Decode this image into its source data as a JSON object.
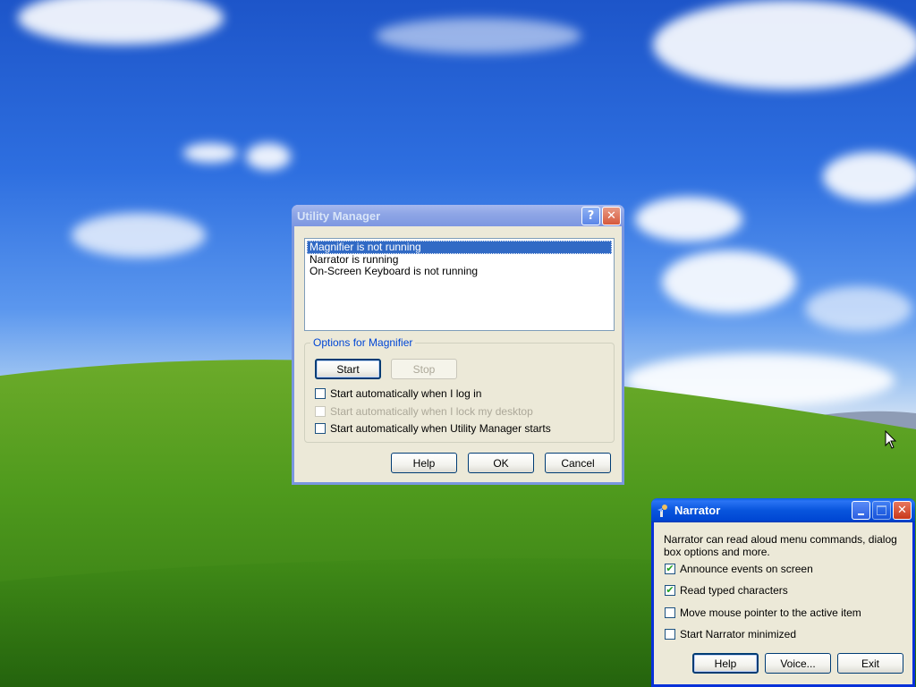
{
  "utility_manager": {
    "title": "Utility Manager",
    "list_items": [
      {
        "label": "Magnifier is not running",
        "selected": true
      },
      {
        "label": "Narrator is running",
        "selected": false
      },
      {
        "label": "On-Screen Keyboard is not running",
        "selected": false
      }
    ],
    "options_group_label": "Options for Magnifier",
    "start_label": "Start",
    "stop_label": "Stop",
    "checkboxes": [
      {
        "label": "Start automatically when I log in",
        "checked": false,
        "enabled": true
      },
      {
        "label": "Start automatically when I lock my desktop",
        "checked": false,
        "enabled": false
      },
      {
        "label": "Start automatically when Utility Manager starts",
        "checked": false,
        "enabled": true
      }
    ],
    "help_label": "Help",
    "ok_label": "OK",
    "cancel_label": "Cancel",
    "help_icon": "?",
    "close_icon": "✕"
  },
  "narrator": {
    "title": "Narrator",
    "description": "Narrator can read aloud menu commands, dialog box options and more.",
    "checkboxes": [
      {
        "label": "Announce events on screen",
        "checked": true
      },
      {
        "label": "Read typed characters",
        "checked": true
      },
      {
        "label": "Move mouse pointer to the active item",
        "checked": false
      },
      {
        "label": "Start Narrator minimized",
        "checked": false
      }
    ],
    "help_label": "Help",
    "voice_label": "Voice...",
    "exit_label": "Exit"
  }
}
